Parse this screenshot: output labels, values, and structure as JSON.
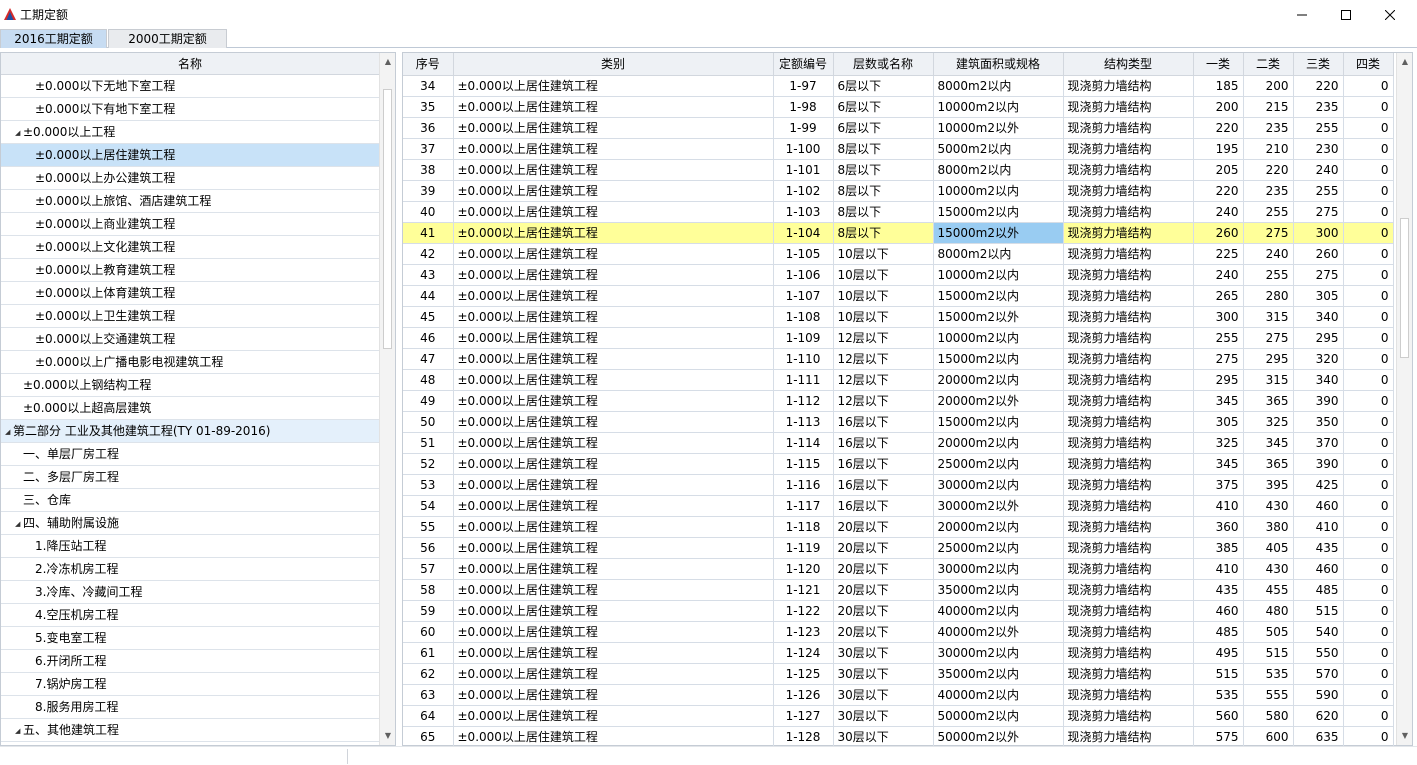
{
  "window": {
    "title": "工期定额",
    "controls": {
      "minimize": "–",
      "maximize": "☐",
      "close": "✕"
    },
    "icon": "app-triangle-icon"
  },
  "tabs": [
    {
      "label": "2016工期定额",
      "active": true
    },
    {
      "label": "2000工期定额",
      "active": false
    }
  ],
  "tree": {
    "header": "名称",
    "items": [
      {
        "label": "±0.000以下无地下室工程",
        "level": 3,
        "expanded": null,
        "selected": false
      },
      {
        "label": "±0.000以下有地下室工程",
        "level": 3,
        "expanded": null,
        "selected": false
      },
      {
        "label": "±0.000以上工程",
        "level": 2,
        "expanded": true,
        "selected": false
      },
      {
        "label": "±0.000以上居住建筑工程",
        "level": 3,
        "expanded": null,
        "selected": true
      },
      {
        "label": "±0.000以上办公建筑工程",
        "level": 3,
        "expanded": null,
        "selected": false
      },
      {
        "label": "±0.000以上旅馆、酒店建筑工程",
        "level": 3,
        "expanded": null,
        "selected": false
      },
      {
        "label": "±0.000以上商业建筑工程",
        "level": 3,
        "expanded": null,
        "selected": false
      },
      {
        "label": "±0.000以上文化建筑工程",
        "level": 3,
        "expanded": null,
        "selected": false
      },
      {
        "label": "±0.000以上教育建筑工程",
        "level": 3,
        "expanded": null,
        "selected": false
      },
      {
        "label": "±0.000以上体育建筑工程",
        "level": 3,
        "expanded": null,
        "selected": false
      },
      {
        "label": "±0.000以上卫生建筑工程",
        "level": 3,
        "expanded": null,
        "selected": false
      },
      {
        "label": "±0.000以上交通建筑工程",
        "level": 3,
        "expanded": null,
        "selected": false
      },
      {
        "label": "±0.000以上广播电影电视建筑工程",
        "level": 3,
        "expanded": null,
        "selected": false
      },
      {
        "label": "±0.000以上钢结构工程",
        "level": 2,
        "expanded": null,
        "selected": false
      },
      {
        "label": "±0.000以上超高层建筑",
        "level": 2,
        "expanded": null,
        "selected": false
      },
      {
        "label": "第二部分 工业及其他建筑工程(TY 01-89-2016)",
        "level": 0,
        "expanded": true,
        "selected": false,
        "group": true
      },
      {
        "label": "一、单层厂房工程",
        "level": 1,
        "expanded": null,
        "selected": false
      },
      {
        "label": "二、多层厂房工程",
        "level": 1,
        "expanded": null,
        "selected": false
      },
      {
        "label": "三、仓库",
        "level": 1,
        "expanded": null,
        "selected": false
      },
      {
        "label": "四、辅助附属设施",
        "level": 1,
        "expanded": true,
        "selected": false
      },
      {
        "label": "1.降压站工程",
        "level": 3,
        "expanded": null,
        "selected": false
      },
      {
        "label": "2.冷冻机房工程",
        "level": 3,
        "expanded": null,
        "selected": false
      },
      {
        "label": "3.冷库、冷藏间工程",
        "level": 3,
        "expanded": null,
        "selected": false
      },
      {
        "label": "4.空压机房工程",
        "level": 3,
        "expanded": null,
        "selected": false
      },
      {
        "label": "5.变电室工程",
        "level": 3,
        "expanded": null,
        "selected": false
      },
      {
        "label": "6.开闭所工程",
        "level": 3,
        "expanded": null,
        "selected": false
      },
      {
        "label": "7.锅炉房工程",
        "level": 3,
        "expanded": null,
        "selected": false
      },
      {
        "label": "8.服务用房工程",
        "level": 3,
        "expanded": null,
        "selected": false
      },
      {
        "label": "五、其他建筑工程",
        "level": 1,
        "expanded": true,
        "selected": false
      }
    ]
  },
  "grid": {
    "columns": [
      "序号",
      "类别",
      "定额编号",
      "层数或名称",
      "建筑面积或规格",
      "结构类型",
      "一类",
      "二类",
      "三类",
      "四类"
    ],
    "highlight_row": 7,
    "rows": [
      [
        "34",
        "±0.000以上居住建筑工程",
        "1-97",
        "6层以下",
        "8000m2以内",
        "现浇剪力墙结构",
        "185",
        "200",
        "220",
        "0"
      ],
      [
        "35",
        "±0.000以上居住建筑工程",
        "1-98",
        "6层以下",
        "10000m2以内",
        "现浇剪力墙结构",
        "200",
        "215",
        "235",
        "0"
      ],
      [
        "36",
        "±0.000以上居住建筑工程",
        "1-99",
        "6层以下",
        "10000m2以外",
        "现浇剪力墙结构",
        "220",
        "235",
        "255",
        "0"
      ],
      [
        "37",
        "±0.000以上居住建筑工程",
        "1-100",
        "8层以下",
        "5000m2以内",
        "现浇剪力墙结构",
        "195",
        "210",
        "230",
        "0"
      ],
      [
        "38",
        "±0.000以上居住建筑工程",
        "1-101",
        "8层以下",
        "8000m2以内",
        "现浇剪力墙结构",
        "205",
        "220",
        "240",
        "0"
      ],
      [
        "39",
        "±0.000以上居住建筑工程",
        "1-102",
        "8层以下",
        "10000m2以内",
        "现浇剪力墙结构",
        "220",
        "235",
        "255",
        "0"
      ],
      [
        "40",
        "±0.000以上居住建筑工程",
        "1-103",
        "8层以下",
        "15000m2以内",
        "现浇剪力墙结构",
        "240",
        "255",
        "275",
        "0"
      ],
      [
        "41",
        "±0.000以上居住建筑工程",
        "1-104",
        "8层以下",
        "15000m2以外",
        "现浇剪力墙结构",
        "260",
        "275",
        "300",
        "0"
      ],
      [
        "42",
        "±0.000以上居住建筑工程",
        "1-105",
        "10层以下",
        "8000m2以内",
        "现浇剪力墙结构",
        "225",
        "240",
        "260",
        "0"
      ],
      [
        "43",
        "±0.000以上居住建筑工程",
        "1-106",
        "10层以下",
        "10000m2以内",
        "现浇剪力墙结构",
        "240",
        "255",
        "275",
        "0"
      ],
      [
        "44",
        "±0.000以上居住建筑工程",
        "1-107",
        "10层以下",
        "15000m2以内",
        "现浇剪力墙结构",
        "265",
        "280",
        "305",
        "0"
      ],
      [
        "45",
        "±0.000以上居住建筑工程",
        "1-108",
        "10层以下",
        "15000m2以外",
        "现浇剪力墙结构",
        "300",
        "315",
        "340",
        "0"
      ],
      [
        "46",
        "±0.000以上居住建筑工程",
        "1-109",
        "12层以下",
        "10000m2以内",
        "现浇剪力墙结构",
        "255",
        "275",
        "295",
        "0"
      ],
      [
        "47",
        "±0.000以上居住建筑工程",
        "1-110",
        "12层以下",
        "15000m2以内",
        "现浇剪力墙结构",
        "275",
        "295",
        "320",
        "0"
      ],
      [
        "48",
        "±0.000以上居住建筑工程",
        "1-111",
        "12层以下",
        "20000m2以内",
        "现浇剪力墙结构",
        "295",
        "315",
        "340",
        "0"
      ],
      [
        "49",
        "±0.000以上居住建筑工程",
        "1-112",
        "12层以下",
        "20000m2以外",
        "现浇剪力墙结构",
        "345",
        "365",
        "390",
        "0"
      ],
      [
        "50",
        "±0.000以上居住建筑工程",
        "1-113",
        "16层以下",
        "15000m2以内",
        "现浇剪力墙结构",
        "305",
        "325",
        "350",
        "0"
      ],
      [
        "51",
        "±0.000以上居住建筑工程",
        "1-114",
        "16层以下",
        "20000m2以内",
        "现浇剪力墙结构",
        "325",
        "345",
        "370",
        "0"
      ],
      [
        "52",
        "±0.000以上居住建筑工程",
        "1-115",
        "16层以下",
        "25000m2以内",
        "现浇剪力墙结构",
        "345",
        "365",
        "390",
        "0"
      ],
      [
        "53",
        "±0.000以上居住建筑工程",
        "1-116",
        "16层以下",
        "30000m2以内",
        "现浇剪力墙结构",
        "375",
        "395",
        "425",
        "0"
      ],
      [
        "54",
        "±0.000以上居住建筑工程",
        "1-117",
        "16层以下",
        "30000m2以外",
        "现浇剪力墙结构",
        "410",
        "430",
        "460",
        "0"
      ],
      [
        "55",
        "±0.000以上居住建筑工程",
        "1-118",
        "20层以下",
        "20000m2以内",
        "现浇剪力墙结构",
        "360",
        "380",
        "410",
        "0"
      ],
      [
        "56",
        "±0.000以上居住建筑工程",
        "1-119",
        "20层以下",
        "25000m2以内",
        "现浇剪力墙结构",
        "385",
        "405",
        "435",
        "0"
      ],
      [
        "57",
        "±0.000以上居住建筑工程",
        "1-120",
        "20层以下",
        "30000m2以内",
        "现浇剪力墙结构",
        "410",
        "430",
        "460",
        "0"
      ],
      [
        "58",
        "±0.000以上居住建筑工程",
        "1-121",
        "20层以下",
        "35000m2以内",
        "现浇剪力墙结构",
        "435",
        "455",
        "485",
        "0"
      ],
      [
        "59",
        "±0.000以上居住建筑工程",
        "1-122",
        "20层以下",
        "40000m2以内",
        "现浇剪力墙结构",
        "460",
        "480",
        "515",
        "0"
      ],
      [
        "60",
        "±0.000以上居住建筑工程",
        "1-123",
        "20层以下",
        "40000m2以外",
        "现浇剪力墙结构",
        "485",
        "505",
        "540",
        "0"
      ],
      [
        "61",
        "±0.000以上居住建筑工程",
        "1-124",
        "30层以下",
        "30000m2以内",
        "现浇剪力墙结构",
        "495",
        "515",
        "550",
        "0"
      ],
      [
        "62",
        "±0.000以上居住建筑工程",
        "1-125",
        "30层以下",
        "35000m2以内",
        "现浇剪力墙结构",
        "515",
        "535",
        "570",
        "0"
      ],
      [
        "63",
        "±0.000以上居住建筑工程",
        "1-126",
        "30层以下",
        "40000m2以内",
        "现浇剪力墙结构",
        "535",
        "555",
        "590",
        "0"
      ],
      [
        "64",
        "±0.000以上居住建筑工程",
        "1-127",
        "30层以下",
        "50000m2以内",
        "现浇剪力墙结构",
        "560",
        "580",
        "620",
        "0"
      ],
      [
        "65",
        "±0.000以上居住建筑工程",
        "1-128",
        "30层以下",
        "50000m2以外",
        "现浇剪力墙结构",
        "575",
        "600",
        "635",
        "0"
      ]
    ]
  }
}
